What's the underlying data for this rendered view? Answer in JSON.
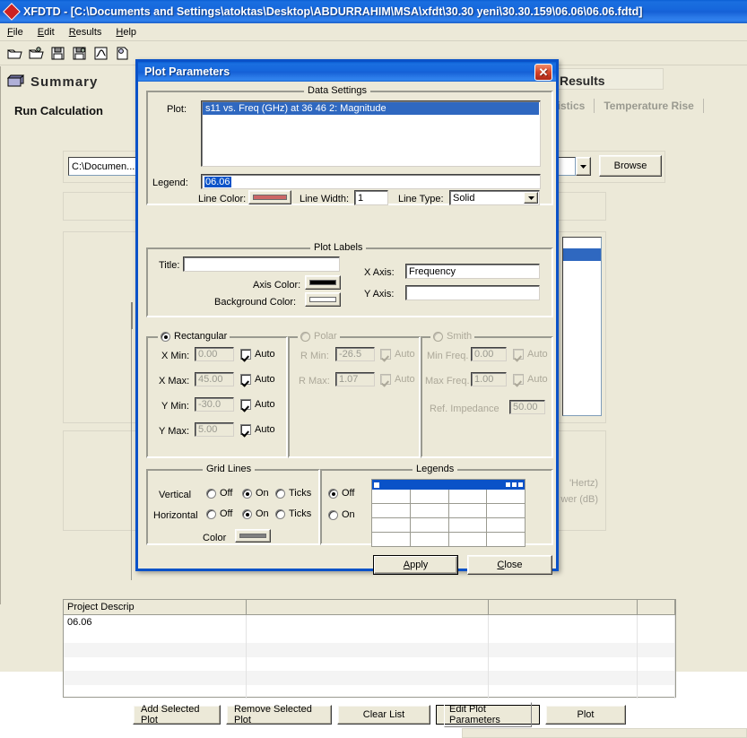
{
  "window": {
    "title": "XFDTD - [C:\\Documents and Settings\\atoktas\\Desktop\\ABDURRAHIM\\MSA\\xfdt\\30.30 yeni\\30.30.159\\06.06\\06.06.fdtd]",
    "app_icon": "diamond-icon"
  },
  "menu": [
    {
      "label": "File",
      "accel": "F"
    },
    {
      "label": "Edit",
      "accel": "E"
    },
    {
      "label": "Results",
      "accel": "R"
    },
    {
      "label": "Help",
      "accel": "H"
    }
  ],
  "toolbar": [
    {
      "name": "open-project-icon",
      "title": "Open"
    },
    {
      "name": "open-geometry-icon",
      "title": "Open Geometry"
    },
    {
      "name": "save-icon",
      "title": "Save"
    },
    {
      "name": "save-as-icon",
      "title": "Save As"
    },
    {
      "name": "plot-curve-icon",
      "title": "Plot"
    },
    {
      "name": "document-icon",
      "title": "Document"
    }
  ],
  "background": {
    "summary_heading": "Summary",
    "summary_icon": "monitor-icon",
    "run_calculation_label": "Run Calculation",
    "results_heading": "Results",
    "tabs": [
      {
        "label": "atistics",
        "enabled": false
      },
      {
        "label": "Temperature Rise",
        "enabled": false
      }
    ],
    "path_value": "C:\\Documen...",
    "browse_label": "Browse",
    "axis_ghost_labels": [
      "'Hertz)",
      "wer (dB)"
    ],
    "project_table": {
      "columns": [
        "Project Descrip",
        "",
        "",
        ""
      ],
      "rows": [
        [
          "06.06",
          "",
          "",
          ""
        ],
        [
          "",
          "",
          "",
          ""
        ],
        [
          "",
          "",
          "",
          ""
        ],
        [
          "",
          "",
          "",
          ""
        ],
        [
          "",
          "",
          "",
          ""
        ],
        [
          "",
          "",
          "",
          ""
        ]
      ]
    },
    "buttons": [
      {
        "label": "Add Selected Plot",
        "default": false
      },
      {
        "label": "Remove Selected Plot",
        "default": false
      },
      {
        "label": "Clear List",
        "default": false
      },
      {
        "label": "Edit Plot Parameters",
        "default": true
      },
      {
        "label": "Plot",
        "default": false
      }
    ]
  },
  "dialog": {
    "title": "Plot Parameters",
    "close_icon": "close-x-icon",
    "data_settings": {
      "legend_title": "Data Settings",
      "plot_label": "Plot:",
      "plot_items": [
        "s11 vs. Freq (GHz) at 36 46 2: Magnitude"
      ],
      "legend_label": "Legend:",
      "legend_value": "06.06",
      "line_color_label": "Line Color:",
      "line_color": "#cc6666",
      "line_width_label": "Line Width:",
      "line_width": "1",
      "line_type_label": "Line Type:",
      "line_type": "Solid"
    },
    "plot_labels": {
      "legend_title": "Plot Labels",
      "title_label": "Title:",
      "title_value": "",
      "axis_color_label": "Axis Color:",
      "axis_color": "#000000",
      "background_color_label": "Background Color:",
      "background_color": "#ffffff",
      "x_axis_label": "X Axis:",
      "x_axis_value": "Frequency",
      "y_axis_label": "Y Axis:",
      "y_axis_value": ""
    },
    "rectangular": {
      "legend_title": "Rectangular",
      "selected": true,
      "fields": [
        {
          "label": "X Min:",
          "value": "0.00",
          "auto_label": "Auto",
          "auto": true
        },
        {
          "label": "X Max:",
          "value": "45.00",
          "auto_label": "Auto",
          "auto": true
        },
        {
          "label": "Y Min:",
          "value": "-30.0",
          "auto_label": "Auto",
          "auto": true
        },
        {
          "label": "Y Max:",
          "value": "5.00",
          "auto_label": "Auto",
          "auto": true
        }
      ]
    },
    "polar": {
      "legend_title": "Polar",
      "selected": false,
      "fields": [
        {
          "label": "R Min:",
          "value": "-26.5",
          "auto_label": "Auto",
          "auto": true
        },
        {
          "label": "R Max:",
          "value": "1.07",
          "auto_label": "Auto",
          "auto": true
        }
      ]
    },
    "smith": {
      "legend_title": "Smith",
      "selected": false,
      "fields": [
        {
          "label": "Min Freq.",
          "value": "0.00",
          "auto_label": "Auto",
          "auto": true
        },
        {
          "label": "Max Freq.",
          "value": "1.00",
          "auto_label": "Auto",
          "auto": true
        }
      ],
      "ref_impedance_label": "Ref. Impedance",
      "ref_impedance_value": "50.00"
    },
    "grid_lines": {
      "legend_title": "Grid Lines",
      "vertical_label": "Vertical",
      "horizontal_label": "Horizontal",
      "options": [
        "Off",
        "On",
        "Ticks"
      ],
      "vertical_selected": "On",
      "horizontal_selected": "On",
      "color_label": "Color",
      "color": "#808080"
    },
    "legends": {
      "legend_title": "Legends",
      "options": [
        "Off",
        "On"
      ],
      "selected": "Off",
      "grid_rows": 4,
      "grid_cols": 4
    },
    "footer": {
      "apply_label": "Apply",
      "apply_accel": "A",
      "close_label": "Close",
      "close_accel": "C"
    }
  }
}
